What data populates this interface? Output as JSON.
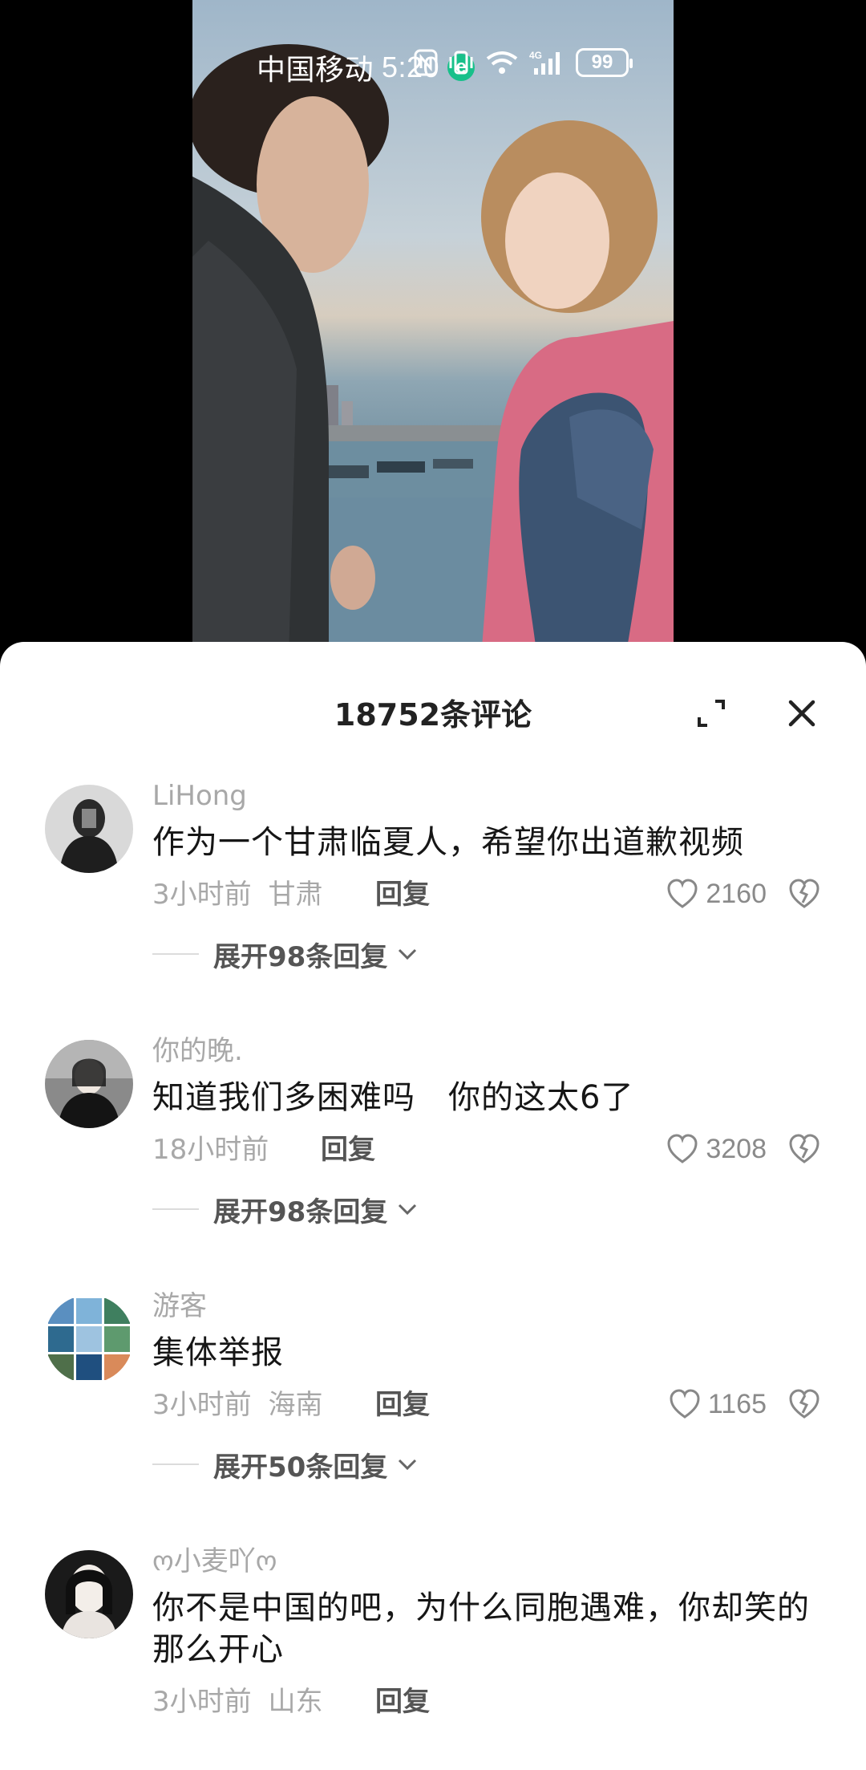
{
  "status_bar": {
    "carrier": "中国移动",
    "time": "5:20",
    "browser_badge": "e",
    "battery": "99"
  },
  "sheet": {
    "title": "18752条评论"
  },
  "comments": [
    {
      "user": "LiHong",
      "text": "作为一个甘肃临夏人，希望你出道歉视频",
      "time": "3小时前",
      "location": "甘肃",
      "reply_label": "回复",
      "likes": "2160",
      "expand_label": "展开98条回复"
    },
    {
      "user": "你的晚.",
      "text": "知道我们多困难吗　你的这太6了",
      "time": "18小时前",
      "location": "",
      "reply_label": "回复",
      "likes": "3208",
      "expand_label": "展开98条回复"
    },
    {
      "user": "游客",
      "text": "集体举报",
      "time": "3小时前",
      "location": "海南",
      "reply_label": "回复",
      "likes": "1165",
      "expand_label": "展开50条回复"
    },
    {
      "user": "ო小麦吖ო",
      "text": "你不是中国的吧，为什么同胞遇难，你却笑的那么开心",
      "time": "3小时前",
      "location": "山东",
      "reply_label": "回复"
    }
  ]
}
